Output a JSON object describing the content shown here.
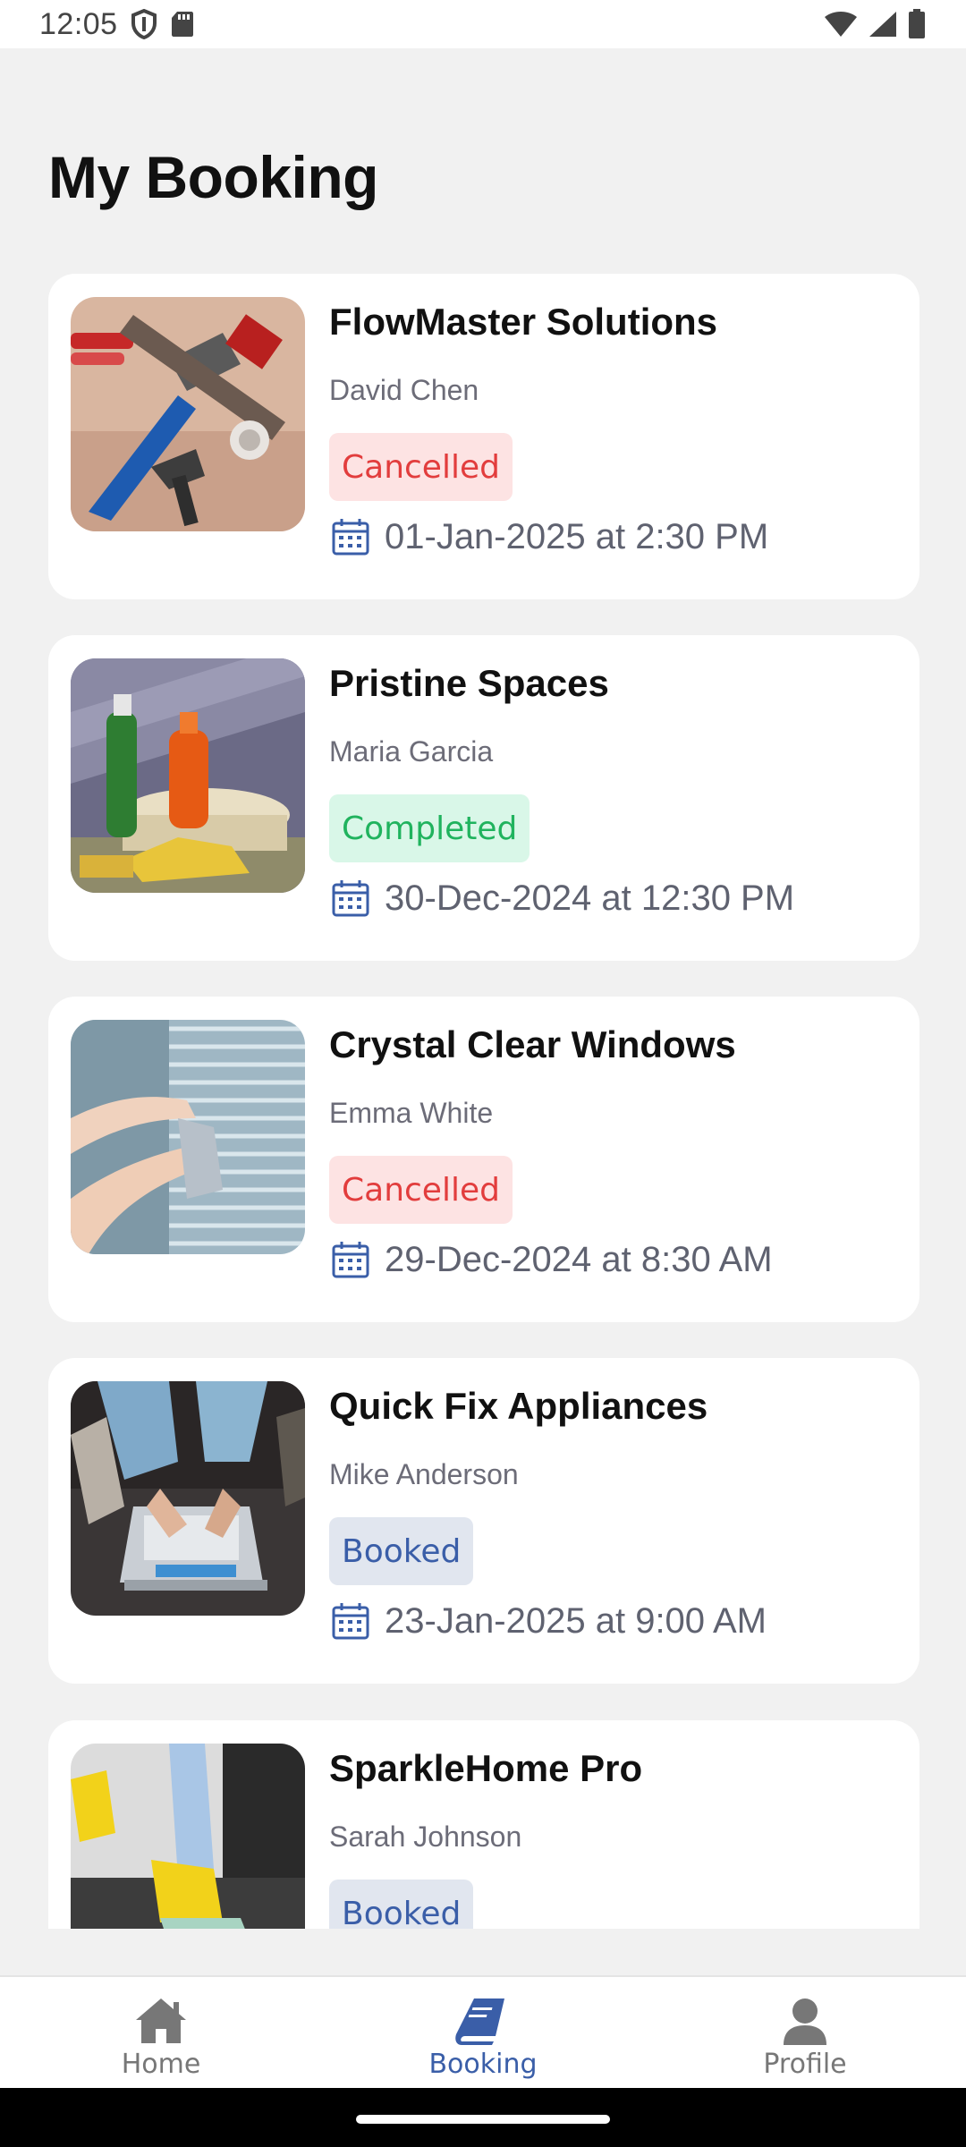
{
  "status_bar": {
    "time": "12:05"
  },
  "page": {
    "title": "My Booking"
  },
  "bookings": [
    {
      "title": "FlowMaster Solutions",
      "person": "David Chen",
      "status": "Cancelled",
      "status_type": "cancelled",
      "datetime": "01-Jan-2025 at 2:30 PM"
    },
    {
      "title": "Pristine Spaces",
      "person": "Maria Garcia",
      "status": "Completed",
      "status_type": "completed",
      "datetime": "30-Dec-2024 at 12:30 PM"
    },
    {
      "title": "Crystal Clear Windows",
      "person": "Emma White",
      "status": "Cancelled",
      "status_type": "cancelled",
      "datetime": "29-Dec-2024 at 8:30 AM"
    },
    {
      "title": "Quick Fix Appliances",
      "person": "Mike Anderson",
      "status": "Booked",
      "status_type": "booked",
      "datetime": "23-Jan-2025 at 9:00 AM"
    },
    {
      "title": "SparkleHome Pro",
      "person": "Sarah Johnson",
      "status": "Booked",
      "status_type": "booked",
      "datetime": ""
    }
  ],
  "bottom_nav": {
    "items": [
      {
        "label": "Home",
        "icon": "home-icon",
        "active": false
      },
      {
        "label": "Booking",
        "icon": "book-icon",
        "active": true
      },
      {
        "label": "Profile",
        "icon": "person-icon",
        "active": false
      }
    ]
  },
  "colors": {
    "accent": "#3a5ea8",
    "cancelled": "#e23d3d",
    "completed": "#20b35e",
    "background": "#f1f1f1"
  }
}
